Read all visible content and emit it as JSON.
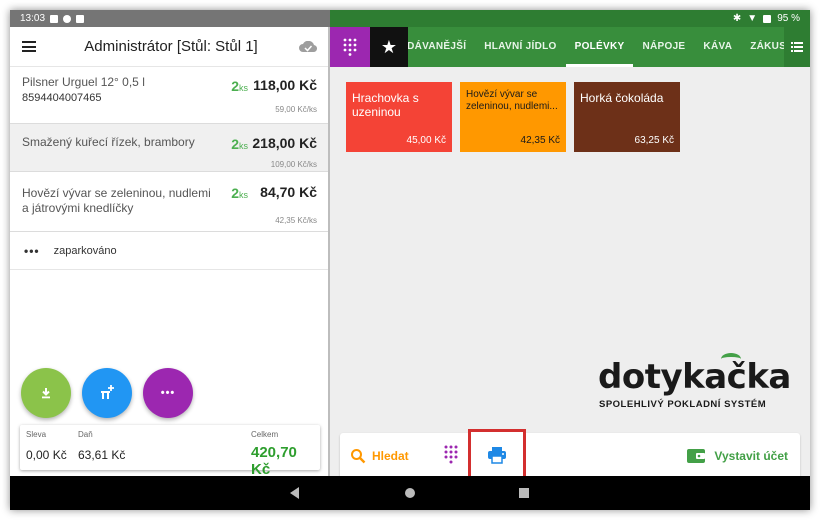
{
  "status_bar": {
    "time": "13:03",
    "battery": "95 %"
  },
  "order": {
    "title": "Administrátor [Stůl: Stůl 1]",
    "items": [
      {
        "name": "Pilsner Urguel 12° 0,5 l",
        "code": "8594404007465",
        "qty": "2",
        "qty_unit": "ks",
        "price": "118,00 Kč",
        "unit_price": "59,00 Kč/ks"
      },
      {
        "name": "Smažený kuřecí řízek, brambory",
        "code": "",
        "qty": "2",
        "qty_unit": "ks",
        "price": "218,00 Kč",
        "unit_price": "109,00 Kč/ks"
      },
      {
        "name": "Hovězí vývar se zeleninou, nudlemi a játrovými knedlíčky",
        "code": "",
        "qty": "2",
        "qty_unit": "ks",
        "price": "84,70 Kč",
        "unit_price": "42,35 Kč/ks"
      }
    ],
    "parked_label": "zaparkováno",
    "totals": {
      "discount_label": "Sleva",
      "discount_value": "0,00 Kč",
      "tax_label": "Daň",
      "tax_value": "63,61 Kč",
      "total_label": "Celkem",
      "total_value": "420,70 Kč"
    }
  },
  "menu": {
    "tabs": [
      "OBLÍBENÉ",
      "ODÁVANĚJŠÍ",
      "HLAVNÍ JÍDLO",
      "POLÉVKY",
      "NÁPOJE",
      "KÁVA",
      "ZÁKUSKY"
    ],
    "active_tab": "POLÉVKY",
    "tiles": [
      {
        "name": "Hrachovka s uzeninou",
        "price": "45,00 Kč",
        "color": "#f44336"
      },
      {
        "name": "Hovězí vývar se zeleninou, nudlemi...",
        "price": "42,35 Kč",
        "color": "#ff9800"
      },
      {
        "name": "Horká čokoláda",
        "price": "63,25 Kč",
        "color": "#6d3018"
      }
    ]
  },
  "brand": {
    "name": "dotykačka",
    "tagline": "SPOLEHLIVÝ POKLADNÍ SYSTÉM"
  },
  "actions": {
    "search_label": "Hledat",
    "bill_label": "Vystavit účet"
  },
  "colors": {
    "accent_green": "#388e3c",
    "purple": "#9c27b0",
    "orange": "#ff9800",
    "highlight_red": "#d32f2f"
  }
}
